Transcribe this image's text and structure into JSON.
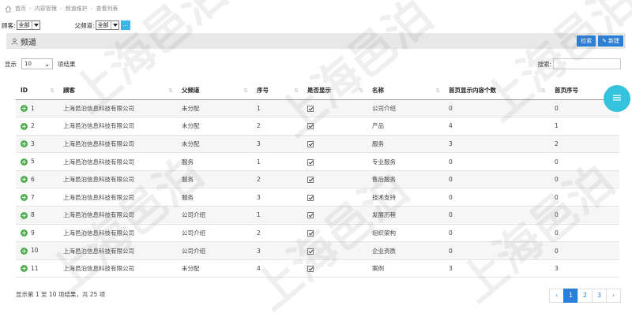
{
  "breadcrumb": [
    "首页",
    "内容管理",
    "频道维护",
    "查看列表"
  ],
  "filters": {
    "customer_label": "顾客:",
    "customer_value": "全部",
    "parent_label": "父频道:",
    "parent_value": "全部",
    "more_label": "..."
  },
  "panel": {
    "title": "频道",
    "query_button": "检索",
    "new_button": "新建"
  },
  "length": {
    "prefix": "显示",
    "value": "10",
    "suffix": "项结果"
  },
  "search": {
    "label": "搜索:",
    "value": ""
  },
  "table": {
    "headers": [
      "ID",
      "顾客",
      "父频道",
      "序号",
      "是否显示",
      "名称",
      "首页显示内容个数",
      "首页序号"
    ],
    "rows": [
      {
        "id": "1",
        "customer": "上海邑泊信息科技有限公司",
        "parent": "未分配",
        "seq": "1",
        "visible": true,
        "name": "公司介绍",
        "home_count": "0",
        "home_seq": "0"
      },
      {
        "id": "2",
        "customer": "上海邑泊信息科技有限公司",
        "parent": "未分配",
        "seq": "2",
        "visible": true,
        "name": "产品",
        "home_count": "4",
        "home_seq": "1"
      },
      {
        "id": "3",
        "customer": "上海邑泊信息科技有限公司",
        "parent": "未分配",
        "seq": "3",
        "visible": true,
        "name": "服务",
        "home_count": "3",
        "home_seq": "2"
      },
      {
        "id": "5",
        "customer": "上海邑泊信息科技有限公司",
        "parent": "服务",
        "seq": "1",
        "visible": true,
        "name": "专业服务",
        "home_count": "0",
        "home_seq": "0"
      },
      {
        "id": "6",
        "customer": "上海邑泊信息科技有限公司",
        "parent": "服务",
        "seq": "2",
        "visible": true,
        "name": "售后服务",
        "home_count": "0",
        "home_seq": "0"
      },
      {
        "id": "7",
        "customer": "上海邑泊信息科技有限公司",
        "parent": "服务",
        "seq": "3",
        "visible": true,
        "name": "技术支持",
        "home_count": "0",
        "home_seq": "0"
      },
      {
        "id": "8",
        "customer": "上海邑泊信息科技有限公司",
        "parent": "公司介绍",
        "seq": "1",
        "visible": true,
        "name": "发展历程",
        "home_count": "0",
        "home_seq": "0"
      },
      {
        "id": "9",
        "customer": "上海邑泊信息科技有限公司",
        "parent": "公司介绍",
        "seq": "2",
        "visible": true,
        "name": "组织架构",
        "home_count": "0",
        "home_seq": "0"
      },
      {
        "id": "10",
        "customer": "上海邑泊信息科技有限公司",
        "parent": "公司介绍",
        "seq": "3",
        "visible": true,
        "name": "企业资质",
        "home_count": "0",
        "home_seq": "0"
      },
      {
        "id": "11",
        "customer": "上海邑泊信息科技有限公司",
        "parent": "未分配",
        "seq": "4",
        "visible": true,
        "name": "案例",
        "home_count": "3",
        "home_seq": "3"
      }
    ]
  },
  "info": "显示第 1 至 10 项结果，共 25 项",
  "pagination": {
    "prev": "‹",
    "pages": [
      "1",
      "2",
      "3"
    ],
    "active": "1",
    "next": "›"
  },
  "fab_icon": "menu-icon",
  "watermark_text": "上海邑泊",
  "colors": {
    "primary": "#2a7fd6",
    "fab": "#35c2dc",
    "add": "#4cae4c",
    "titlebar": "#e8e8e8"
  }
}
